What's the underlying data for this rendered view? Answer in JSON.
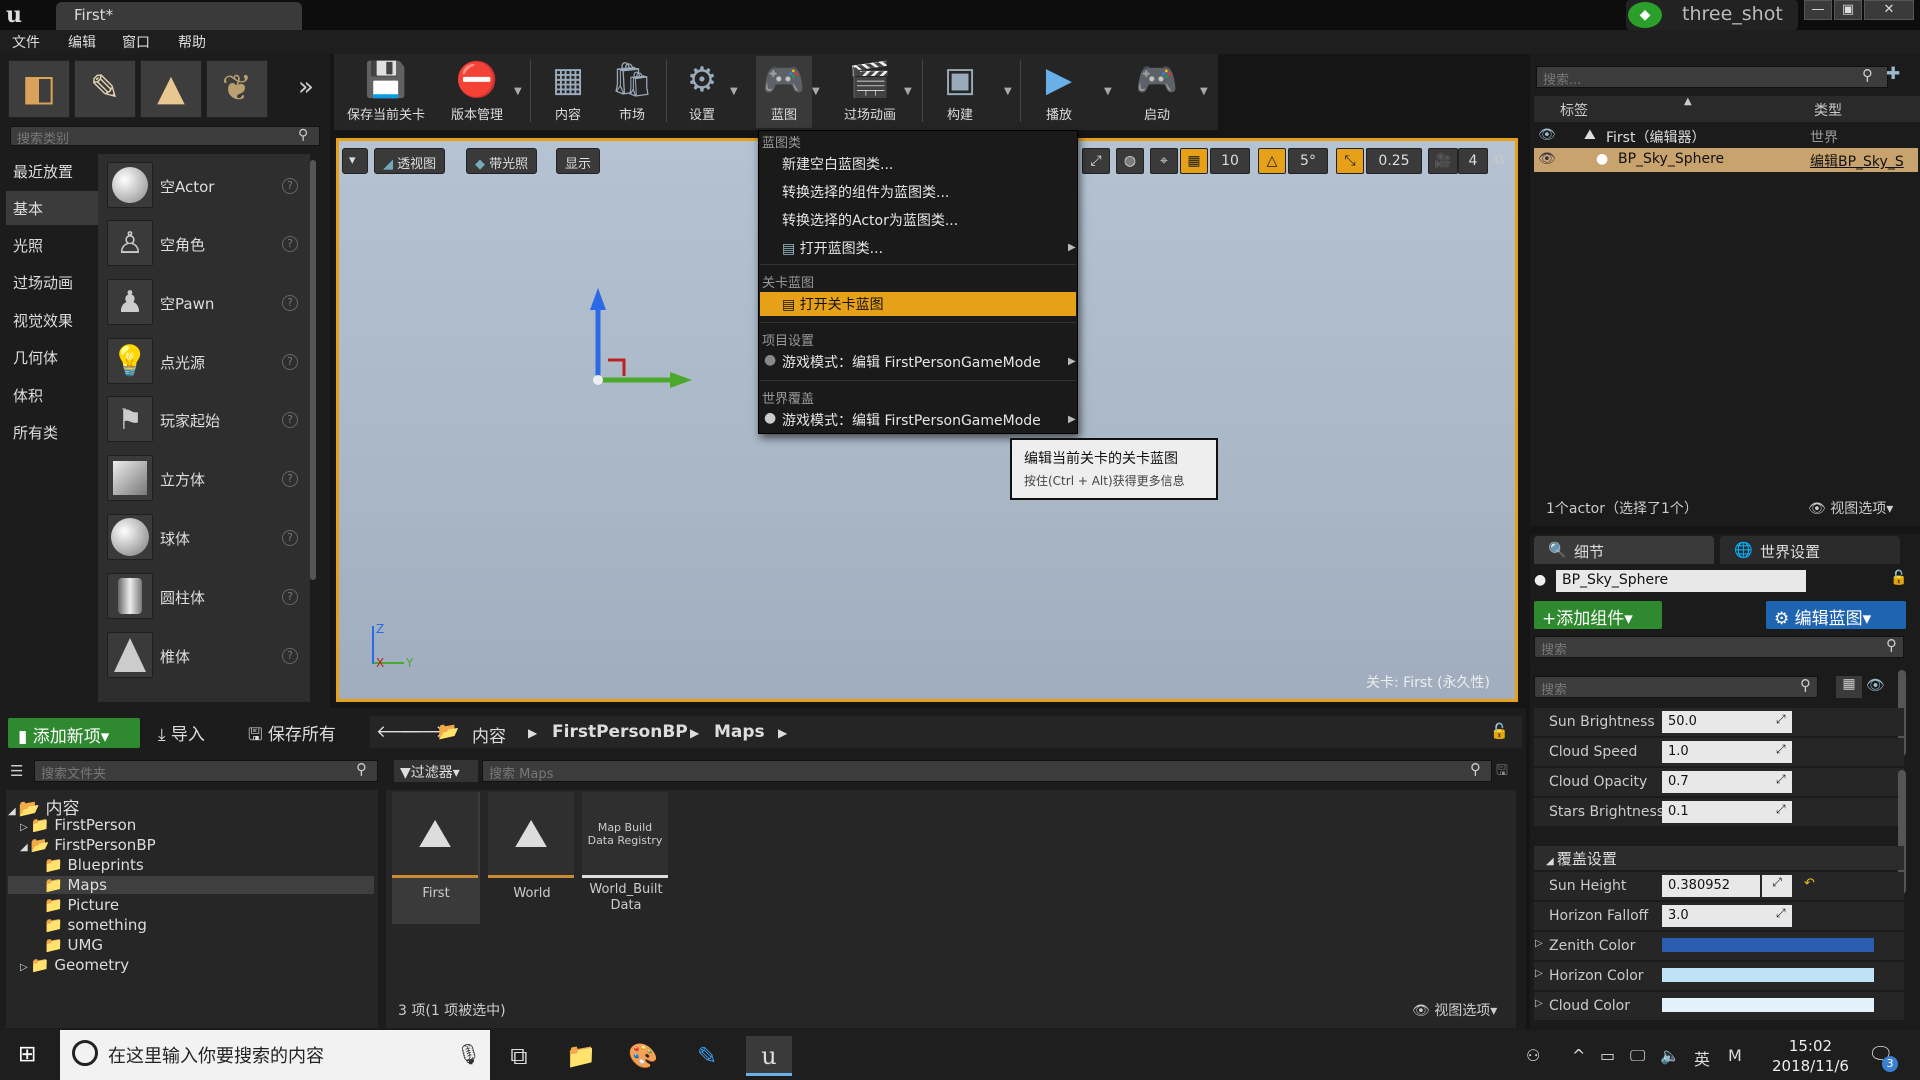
{
  "title_bar": {
    "logo": "u",
    "document_tab": "First*",
    "project_name": "three_shot",
    "window_buttons": [
      "—",
      "▣",
      "✕"
    ]
  },
  "menubar": [
    "文件",
    "编辑",
    "窗口",
    "帮助"
  ],
  "modes_panel": {
    "search_placeholder": "搜索类别",
    "categories": [
      "最近放置",
      "基本",
      "光照",
      "过场动画",
      "视觉效果",
      "几何体",
      "体积",
      "所有类"
    ],
    "selected_category": "基本",
    "actors": [
      "空Actor",
      "空角色",
      "空Pawn",
      "点光源",
      "玩家起始",
      "立方体",
      "球体",
      "圆柱体",
      "椎体"
    ]
  },
  "toolbar": {
    "buttons": [
      "保存当前关卡",
      "版本管理",
      "内容",
      "市场",
      "设置",
      "蓝图",
      "过场动画",
      "构建",
      "播放",
      "启动"
    ]
  },
  "viewport": {
    "controls": [
      "透视图",
      "带光照",
      "显示"
    ],
    "grid_snap": "10",
    "rotation_snap": "5°",
    "scale_snap": "0.25",
    "camera_speed": "4",
    "level_label": "关卡:  First (永久性)",
    "axes": {
      "z": "Z",
      "x": "X",
      "y": "Y"
    }
  },
  "blueprint_menu": {
    "section_blueprint_class": "蓝图类",
    "new_empty": "新建空白蓝图类...",
    "convert_components": "转换选择的组件为蓝图类...",
    "convert_actor": "转换选择的Actor为蓝图类...",
    "open_class": "打开蓝图类...",
    "section_level": "关卡蓝图",
    "open_level": "打开关卡蓝图",
    "section_project": "项目设置",
    "project_gamemode": "游戏模式：编辑 FirstPersonGameMode",
    "section_world": "世界覆盖",
    "world_gamemode": "游戏模式：编辑 FirstPersonGameMode"
  },
  "tooltip": {
    "line1": "编辑当前关卡的关卡蓝图",
    "line2": "按住(Ctrl + Alt)获得更多信息"
  },
  "outliner": {
    "search_placeholder": "搜索...",
    "col_label": "标签",
    "col_type": "类型",
    "rows": [
      {
        "label": "First（编辑器）",
        "type": "世界"
      },
      {
        "label": "BP_Sky_Sphere",
        "type": "编辑BP_Sky_S"
      }
    ],
    "status": "1个actor（选择了1个）",
    "view_options": "视图选项▾"
  },
  "details": {
    "tab_details": "细节",
    "tab_world": "世界设置",
    "actor_name": "BP_Sky_Sphere",
    "add_component": "+添加组件▾",
    "edit_blueprint": "编辑蓝图▾",
    "search1": "搜索",
    "search2": "搜索",
    "properties": [
      {
        "label": "Sun Brightness",
        "value": "50.0"
      },
      {
        "label": "Cloud Speed",
        "value": "1.0"
      },
      {
        "label": "Cloud Opacity",
        "value": "0.7"
      },
      {
        "label": "Stars Brightness",
        "value": "0.1"
      }
    ],
    "section_override": "覆盖设置",
    "override_properties": [
      {
        "label": "Sun Height",
        "value": "0.380952"
      },
      {
        "label": "Horizon Falloff",
        "value": "3.0"
      }
    ],
    "colors": [
      {
        "label": "Zenith Color",
        "color": "#2a5db0"
      },
      {
        "label": "Horizon Color",
        "color": "#bfe2f7"
      },
      {
        "label": "Cloud Color",
        "color": "#e3f1fb"
      }
    ]
  },
  "content_browser": {
    "add_new": "添加新项▾",
    "import": "导入",
    "save_all": "保存所有",
    "breadcrumbs": [
      "内容",
      "FirstPersonBP",
      "Maps"
    ],
    "folder_search_placeholder": "搜索文件夹",
    "filter": "过滤器▾",
    "asset_search_placeholder": "搜索 Maps",
    "tree": [
      {
        "label": "内容",
        "depth": 0
      },
      {
        "label": "FirstPerson",
        "depth": 1
      },
      {
        "label": "FirstPersonBP",
        "depth": 1
      },
      {
        "label": "Blueprints",
        "depth": 2
      },
      {
        "label": "Maps",
        "depth": 2
      },
      {
        "label": "Picture",
        "depth": 2
      },
      {
        "label": "something",
        "depth": 2
      },
      {
        "label": "UMG",
        "depth": 2
      },
      {
        "label": "Geometry",
        "depth": 1
      }
    ],
    "selected_folder": "Maps",
    "assets": [
      {
        "name": "First",
        "thumb": ""
      },
      {
        "name": "World",
        "thumb": ""
      },
      {
        "name": "World_Built Data",
        "thumb": "Map Build Data Registry"
      }
    ],
    "status": "3 项(1 项被选中)",
    "view_options": "视图选项▾"
  },
  "taskbar": {
    "search_placeholder": "在这里输入你要搜索的内容",
    "time": "15:02",
    "date": "2018/11/6",
    "ime": "英",
    "notifications": "3"
  }
}
